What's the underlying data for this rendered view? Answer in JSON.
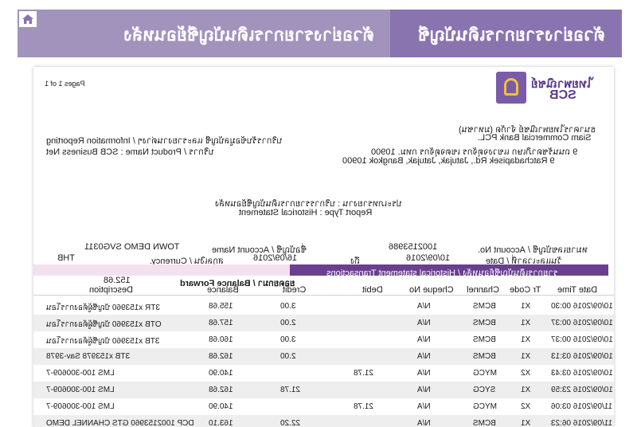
{
  "banner": {
    "left_title": "ตัวอย่างรายการเดินบัญชีย้อนหลัง",
    "right_title": "ตัวอย่างรายการเดินบัญชี"
  },
  "report": {
    "page_label": "Pages 1 of 1",
    "bank_name_th": "ไทยพาณิชย์",
    "bank_short": "SCB",
    "address": [
      "ธนาคารไทยพาณิชย์ จำกัด (มหาชน)",
      "Siam Commercial Bank PCL.",
      "9 ถนนรัชดาภิเษก แขวงจตุจักร เขตจตุจักร กทม. 10900",
      "9 Ratchadapisek Rd., Jatujak, Jatujak, Bangkok 10900"
    ],
    "service": [
      "บริการรับข้อมูลบัญชี และรายงานต่างๆ / Information Reporting",
      "บริการ / Product Name : SCB Business Net"
    ],
    "report_type_th": "ประเภทรายงาน : บริการรายการเดินบัญชีย้อนหลัง",
    "report_type_en": "Report Type : Historical Statement",
    "account": {
      "acct_no_label": "หมายเลขบัญชี / Account No.",
      "acct_no": "1002153986",
      "acct_name_label": "ชื่อบัญชี / Account Name",
      "acct_name": "TOWN DEMO SVG0311",
      "date_label": "วันและเวลาที่ / Date",
      "date_from": "10/09/2016",
      "date_to_label": "ถึง",
      "date_to": "16/09/2016",
      "currency_label": "สกุลเงิน / Currency.",
      "currency": "THB"
    },
    "section_title": "รายการเดินบัญชีย้อนหลัง / Historical statement Transactions",
    "balance_forward_label": "ยอดยกมา / Balance Forward",
    "balance_forward_value": "152.68",
    "columns": [
      "Date Time",
      "Tr Code",
      "Channel",
      "Cheque No",
      "Debit",
      "Credit",
      "Balance",
      "Description"
    ],
    "rows": [
      [
        "10/09/2016 00:30",
        "X1",
        "BCMS",
        "N/A",
        "",
        "3.00",
        "155.68",
        "3TR x153960 บัญชีผู้ต้องการโอน"
      ],
      [
        "10/09/2016 00:37",
        "X1",
        "BCMS",
        "N/A",
        "",
        "2.00",
        "157.68",
        "OTB x153960 บัญชีผู้ต้องการโอน"
      ],
      [
        "10/09/2016 00:37",
        "X1",
        "BCMS",
        "N/A",
        "",
        "3.00",
        "160.68",
        "3TB x153960 บัญชีผู้ต้องการโอน"
      ],
      [
        "10/09/2016 03:13",
        "X1",
        "BCMS",
        "N/A",
        "",
        "2.00",
        "162.68",
        "3TB x153978 Sav-3978"
      ],
      [
        "10/09/2016 03:43",
        "X2",
        "MYCG",
        "N/A",
        "21.78",
        "",
        "140.90",
        "LMS 100-300609-7"
      ],
      [
        "10/09/2016 23:59",
        "X1",
        "SYCG",
        "N/A",
        "",
        "21.78",
        "162.68",
        "LMS 100-300609-7"
      ],
      [
        "11/09/2016 03:06",
        "X2",
        "MYCG",
        "N/A",
        "21.78",
        "",
        "140.90",
        "LMS 100-300609-7"
      ],
      [
        "11/09/2016 06:23",
        "X1",
        "BCMS",
        "N/A",
        "",
        "22.20",
        "163.10",
        "DCP 1002153960 GTS CHANNEL DEMO"
      ]
    ]
  }
}
